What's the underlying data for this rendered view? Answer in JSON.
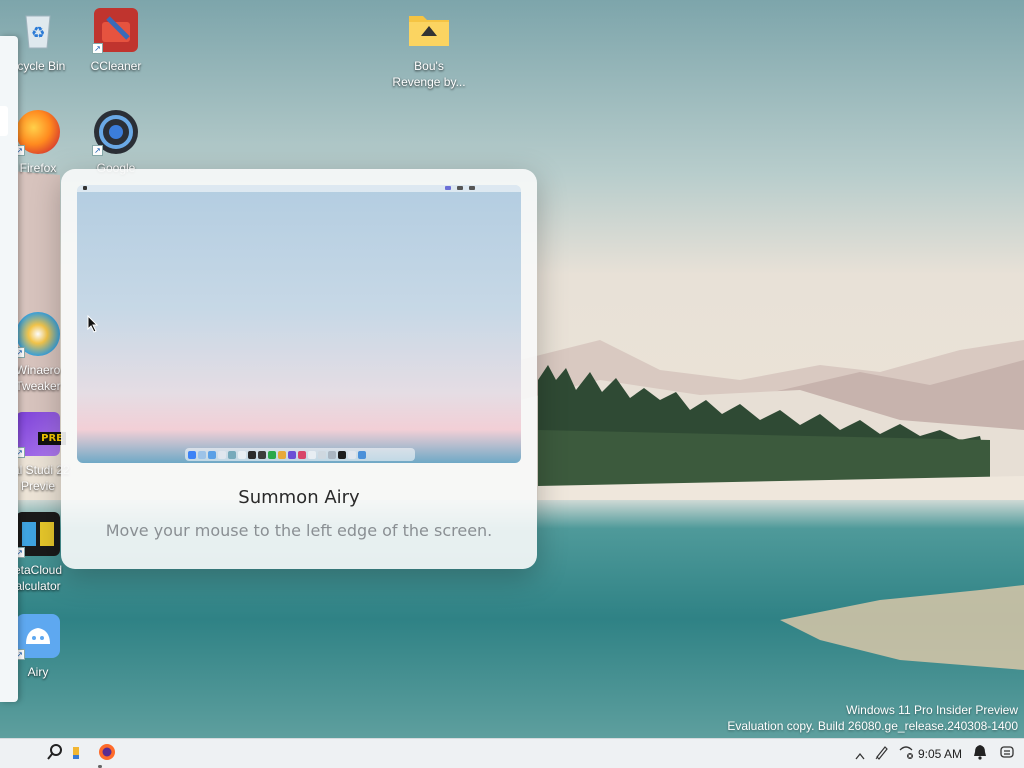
{
  "desktop": {
    "icons": [
      {
        "name": "recycle-bin",
        "label": "ecycle Bin",
        "icon": "recycle-bin-icon"
      },
      {
        "name": "ccleaner",
        "label": "CCleaner",
        "icon": "ccleaner-icon"
      },
      {
        "name": "bous-revenge",
        "label": "Bou's Revenge by...",
        "icon": "folder-icon"
      },
      {
        "name": "firefox",
        "label": "Firefox",
        "icon": "firefox-icon"
      },
      {
        "name": "chrome",
        "label": "Google",
        "icon": "chrome-icon"
      },
      {
        "name": "winaero",
        "label": "Winaero Tweaker",
        "icon": "winaero-icon"
      },
      {
        "name": "visual-studio",
        "label": "ual Studi 22 Previe",
        "badge": "PRE",
        "icon": "visual-studio-icon"
      },
      {
        "name": "betacloud",
        "label": "etaCloud alculator",
        "icon": "betacloud-icon"
      },
      {
        "name": "airy",
        "label": "Airy",
        "icon": "airy-icon"
      }
    ]
  },
  "onboarding": {
    "title": "Summon Airy",
    "description": "Move your mouse to the left edge of the screen."
  },
  "watermark": {
    "line1": "Windows 11 Pro Insider Preview",
    "line2": "Evaluation copy. Build 26080.ge_release.240308-1400"
  },
  "taskbar": {
    "clock": "9:05 AM",
    "pinned": [
      "search-icon",
      "file-explorer-icon",
      "firefox-icon"
    ],
    "tray": [
      "chevron-up-icon",
      "pen-icon",
      "network-disconnected-icon",
      "notification-bell-icon",
      "copilot-icon"
    ]
  },
  "colors": {
    "taskbar_bg": "#eef1f3",
    "card_bg": "#f8fafa",
    "title": "#2a2a2a",
    "description": "#8a8f93"
  }
}
